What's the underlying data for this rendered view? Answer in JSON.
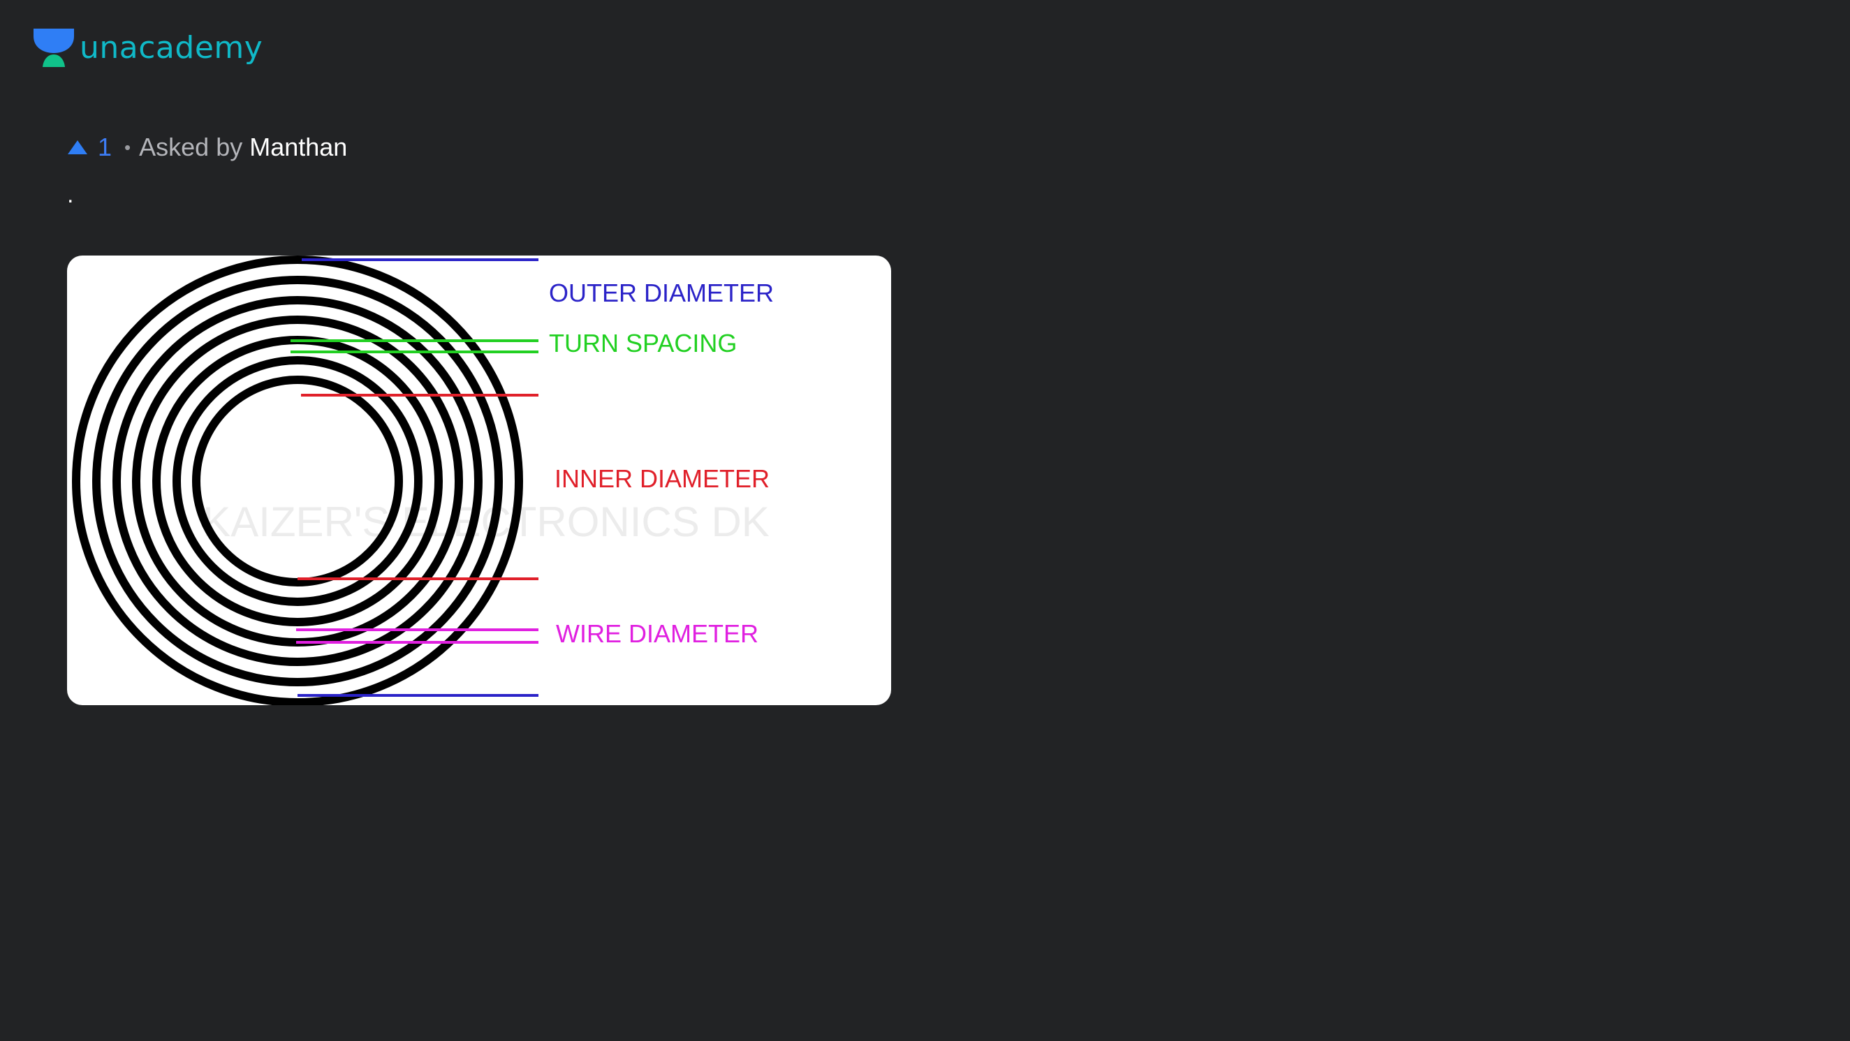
{
  "brand": {
    "name": "unacademy",
    "color": "#10b9c8"
  },
  "question": {
    "upvotes": "1",
    "separator": "•",
    "asked_by_label": "Asked by",
    "asker": "Manthan",
    "text": "."
  },
  "diagram": {
    "labels": {
      "outer_diameter": "OUTER DIAMETER",
      "turn_spacing": "TURN SPACING",
      "inner_diameter": "INNER DIAMETER",
      "wire_diameter": "WIRE DIAMETER"
    },
    "watermark": "KAIZER'S ELECTRONICS DK",
    "colors": {
      "outer_diameter": "#2b23c8",
      "turn_spacing": "#22d022",
      "inner_diameter": "#e0202a",
      "wire_diameter": "#e020e0"
    }
  },
  "icons": {
    "upvote": "upvote-triangle-icon",
    "logo": "unacademy-logo-icon"
  }
}
